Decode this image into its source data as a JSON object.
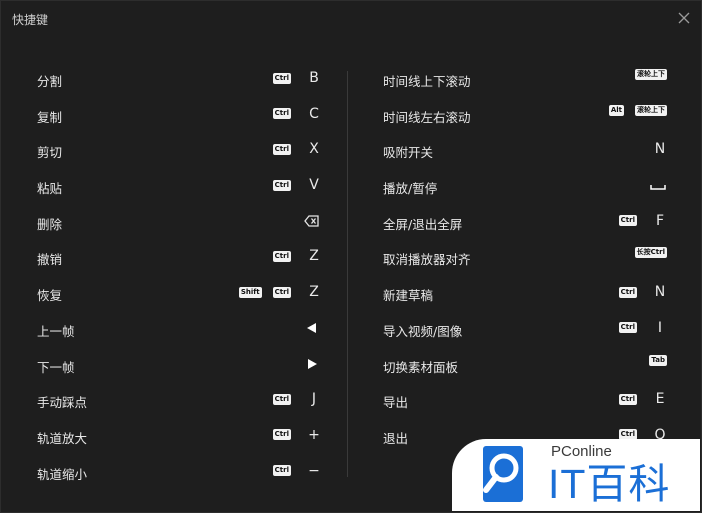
{
  "dialog": {
    "title": "快捷键"
  },
  "left": [
    {
      "label": "分割",
      "badges": [
        "Ctrl"
      ],
      "key": "B"
    },
    {
      "label": "复制",
      "badges": [
        "Ctrl"
      ],
      "key": "C"
    },
    {
      "label": "剪切",
      "badges": [
        "Ctrl"
      ],
      "key": "X"
    },
    {
      "label": "粘贴",
      "badges": [
        "Ctrl"
      ],
      "key": "V"
    },
    {
      "label": "删除",
      "badges": [],
      "icon": "backspace-icon"
    },
    {
      "label": "撤销",
      "badges": [
        "Ctrl"
      ],
      "key": "Z"
    },
    {
      "label": "恢复",
      "badges": [
        "Shift",
        "Ctrl"
      ],
      "key": "Z"
    },
    {
      "label": "上一帧",
      "badges": [],
      "icon": "left-arrow-icon"
    },
    {
      "label": "下一帧",
      "badges": [],
      "icon": "right-arrow-icon"
    },
    {
      "label": "手动踩点",
      "badges": [
        "Ctrl"
      ],
      "key": "J"
    },
    {
      "label": "轨道放大",
      "badges": [
        "Ctrl"
      ],
      "key": "+"
    },
    {
      "label": "轨道缩小",
      "badges": [
        "Ctrl"
      ],
      "key": "−"
    }
  ],
  "right": [
    {
      "label": "时间线上下滚动",
      "badges": [
        "滚轮上下"
      ],
      "key": ""
    },
    {
      "label": "时间线左右滚动",
      "badges": [
        "Alt",
        "滚轮上下"
      ],
      "key": ""
    },
    {
      "label": "吸附开关",
      "badges": [],
      "key": "N"
    },
    {
      "label": "播放/暂停",
      "badges": [],
      "icon": "space-bar-icon"
    },
    {
      "label": "全屏/退出全屏",
      "badges": [
        "Ctrl"
      ],
      "key": "F"
    },
    {
      "label": "取消播放器对齐",
      "badges": [
        "长按Ctrl"
      ],
      "key": ""
    },
    {
      "label": "新建草稿",
      "badges": [
        "Ctrl"
      ],
      "key": "N"
    },
    {
      "label": "导入视频/图像",
      "badges": [
        "Ctrl"
      ],
      "key": "I"
    },
    {
      "label": "切换素材面板",
      "badges": [
        "Tab"
      ],
      "key": ""
    },
    {
      "label": "导出",
      "badges": [
        "Ctrl"
      ],
      "key": "E"
    },
    {
      "label": "退出",
      "badges": [
        "Ctrl"
      ],
      "key": "Q"
    }
  ],
  "watermark": {
    "top": "PConline",
    "brand": "IT百科",
    "brand_color": "#1b6fd6"
  }
}
